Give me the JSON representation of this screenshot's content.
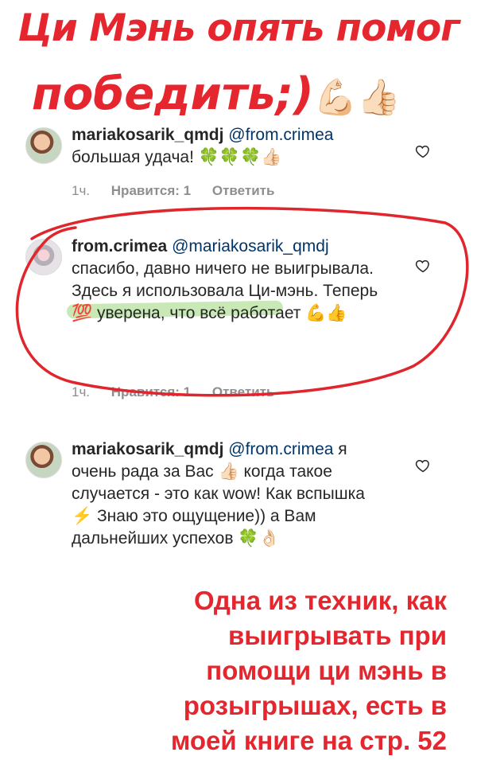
{
  "headline": {
    "line1": "Ци Мэнь опять помог",
    "line2": "победить;)",
    "line2_emojis": "💪🏻👍🏻"
  },
  "comments": [
    {
      "username": "mariakosarik_qmdj",
      "mention": "@from.crimea",
      "text": "большая удача! 🍀🍀🍀👍🏻",
      "time": "1ч.",
      "likes": "Нравится: 1",
      "reply": "Ответить"
    },
    {
      "username": "from.crimea",
      "mention": "@mariakosarik_qmdj",
      "text": "спасибо, давно ничего не выигрывала. Здесь я использовала Ци-мэнь. Теперь 💯 уверена, что всё работает 💪👍",
      "time": "1ч.",
      "likes": "Нравится: 1",
      "reply": "Ответить"
    },
    {
      "username": "mariakosarik_qmdj",
      "mention": "@from.crimea",
      "text": "я очень рада за Вас 👍🏻 когда такое случается - это как wow! Как вспышка ⚡️ Знаю это ощущение)) а Вам дальнейших успехов 🍀👌🏻"
    }
  ],
  "annotation": {
    "lines": [
      "Одна из  техник, как",
      "выигрывать при",
      "помощи ци мэнь в",
      "розыгрышах, есть в",
      "моей книге на стр. 52"
    ]
  },
  "colors": {
    "headline": "#e5262f",
    "mention": "#003569",
    "meta": "#8e8e8e",
    "highlight": "#9ad67a",
    "oval": "#e0262d"
  },
  "icons": [
    "heart-icon",
    "avatar"
  ]
}
